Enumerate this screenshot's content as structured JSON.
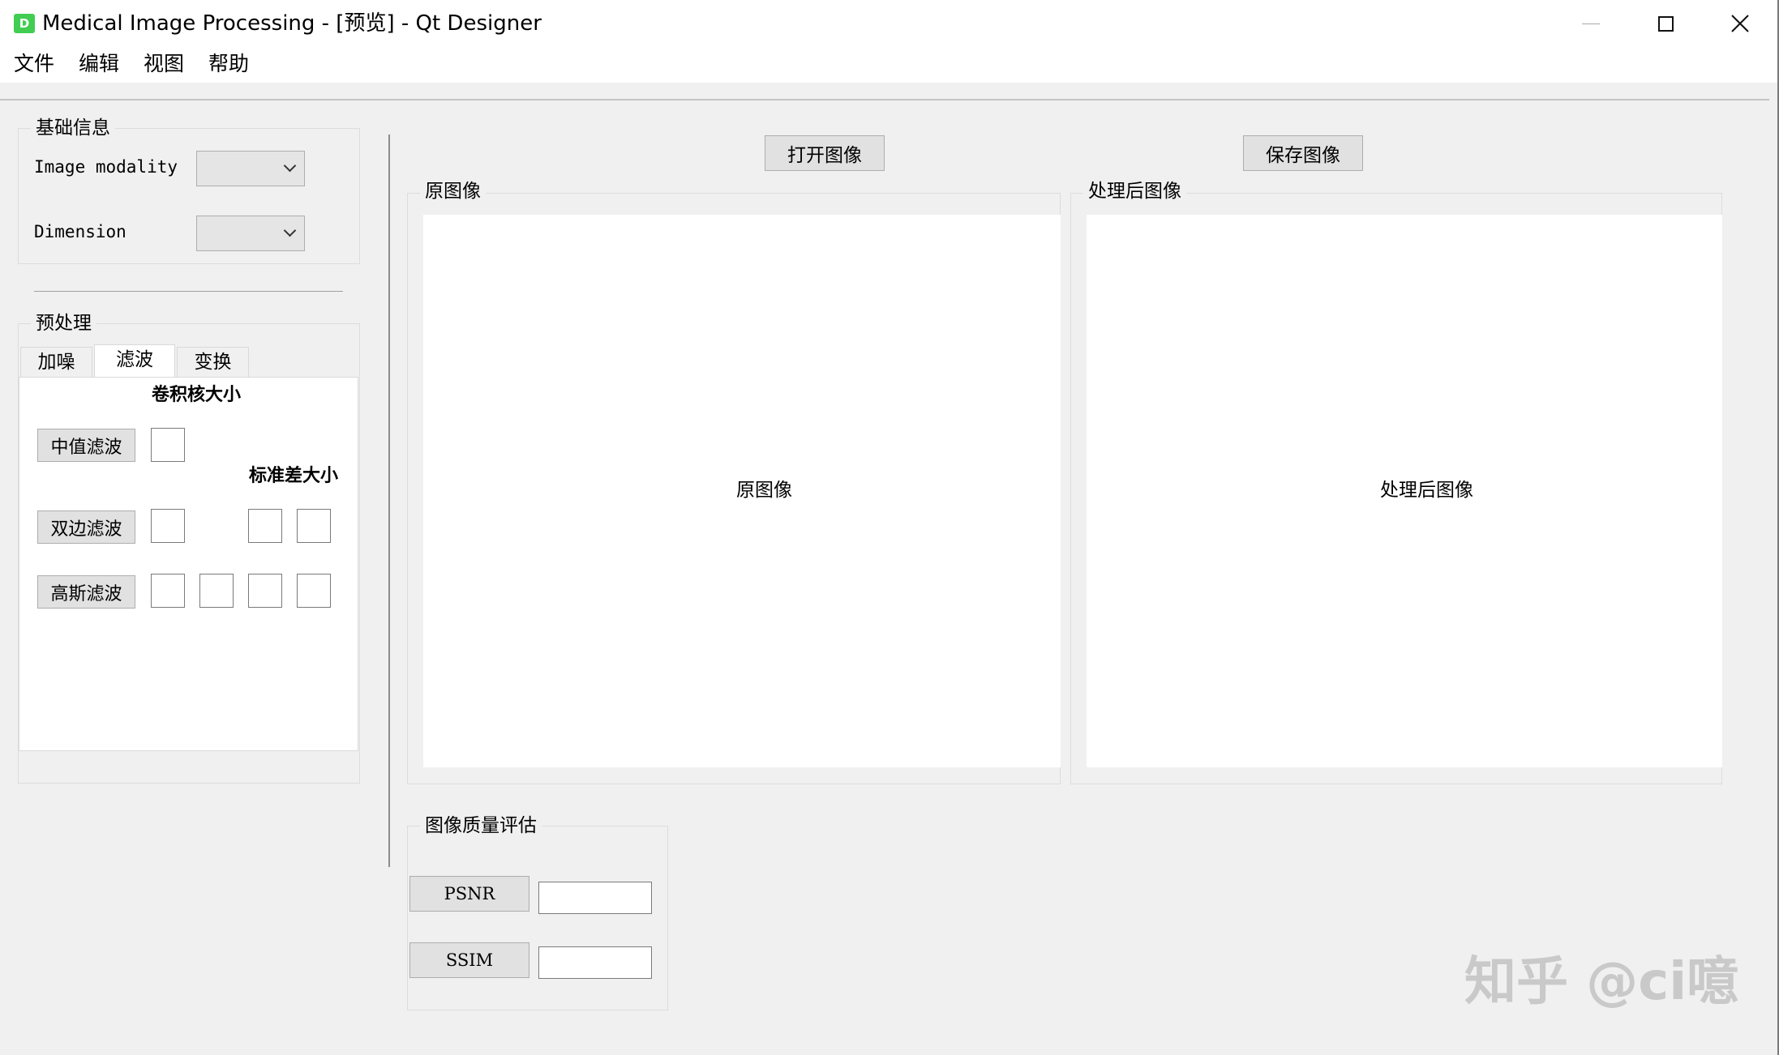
{
  "window": {
    "icon_letter": "D",
    "title": "Medical Image Processing - [预览] - Qt Designer"
  },
  "menubar": {
    "items": [
      "文件",
      "编辑",
      "视图",
      "帮助"
    ]
  },
  "basic_info": {
    "title": "基础信息",
    "modality_label": "Image modality",
    "modality_value": "",
    "dimension_label": "Dimension",
    "dimension_value": ""
  },
  "preprocess": {
    "title": "预处理",
    "tabs": [
      "加噪",
      "滤波",
      "变换"
    ],
    "active_tab": "滤波",
    "kernel_label": "卷积核大小",
    "std_label": "标准差大小",
    "median_button": "中值滤波",
    "bilateral_button": "双边滤波",
    "gaussian_button": "高斯滤波"
  },
  "toolbar": {
    "open_button": "打开图像",
    "save_button": "保存图像"
  },
  "original": {
    "group_title": "原图像",
    "canvas_text": "原图像"
  },
  "processed": {
    "group_title": "处理后图像",
    "canvas_text": "处理后图像"
  },
  "quality": {
    "title": "图像质量评估",
    "psnr_button": "PSNR",
    "psnr_value": "",
    "ssim_button": "SSIM",
    "ssim_value": ""
  },
  "watermark": "知乎 @ci噫"
}
